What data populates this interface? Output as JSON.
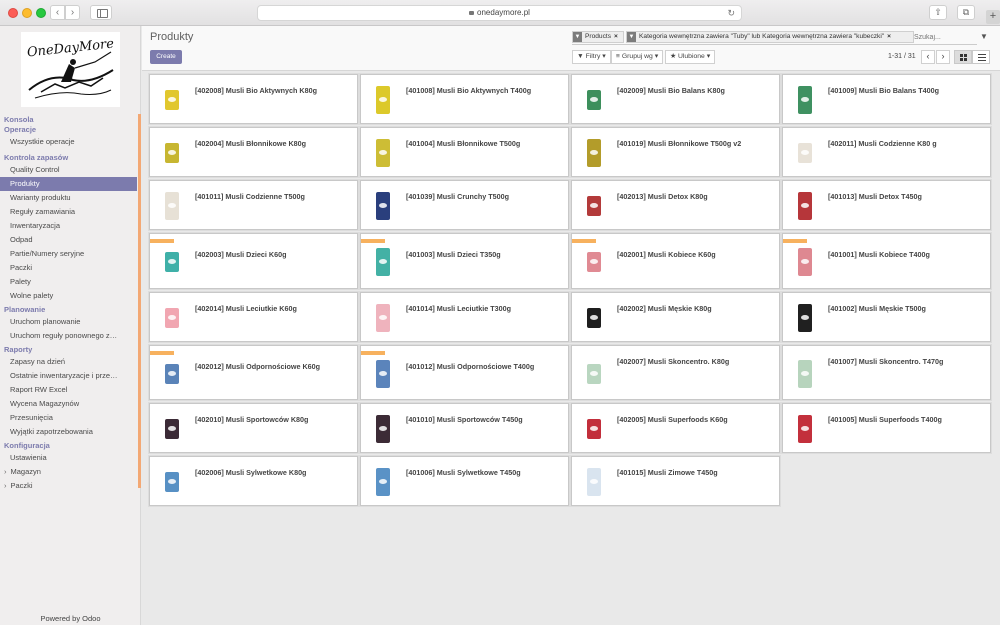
{
  "browser": {
    "url": "onedaymore.pl"
  },
  "sidebar": {
    "logo_text": "OneDayMore",
    "sections": [
      {
        "title": "Konsola",
        "items": []
      },
      {
        "title": "Operacje",
        "items": [
          {
            "label": "Wszystkie operacje"
          }
        ]
      },
      {
        "title": "Kontrola zapasów",
        "items": [
          {
            "label": "Quality Control"
          },
          {
            "label": "Produkty",
            "active": true
          },
          {
            "label": "Warianty produktu"
          },
          {
            "label": "Reguły zamawiania"
          },
          {
            "label": "Inwentaryzacja"
          },
          {
            "label": "Odpad"
          },
          {
            "label": "Partie/Numery seryjne"
          },
          {
            "label": "Paczki"
          },
          {
            "label": "Palety"
          },
          {
            "label": "Wolne palety"
          }
        ]
      },
      {
        "title": "Planowanie",
        "items": [
          {
            "label": "Uruchom planowanie"
          },
          {
            "label": "Uruchom reguły ponownego z…"
          }
        ]
      },
      {
        "title": "Raporty",
        "items": [
          {
            "label": "Zapasy na dzień"
          },
          {
            "label": "Ostatnie inwentaryzacje i prze…"
          },
          {
            "label": "Raport RW Excel"
          },
          {
            "label": "Wycena Magazynów"
          },
          {
            "label": "Przesunięcia"
          },
          {
            "label": "Wyjątki zapotrzebowania"
          }
        ]
      },
      {
        "title": "Konfiguracja",
        "items": [
          {
            "label": "Ustawienia"
          },
          {
            "label": "Magazyn",
            "sub": true
          },
          {
            "label": "Paczki",
            "sub": true
          }
        ]
      }
    ],
    "powered_by": "Powered by Odoo"
  },
  "control_panel": {
    "breadcrumb": "Produkty",
    "create_label": "Create",
    "facets": [
      {
        "label": "Products"
      },
      {
        "label": "Kategoria wewnętrzna zawiera \"Tuby\" lub Kategoria wewnętrzna zawiera \"kubeczki\""
      }
    ],
    "search_placeholder": "Szukaj...",
    "filters_label": "Filtry",
    "groupby_label": "Grupuj wg",
    "favorites_label": "Ulubione",
    "pager": "1-31 / 31"
  },
  "products": [
    {
      "name": "[402008] Musli Bio Aktywnych K80g",
      "color": "#e1c72e",
      "shape": "short",
      "tag": false
    },
    {
      "name": "[401008] Musli Bio Aktywnych T400g",
      "color": "#dcc92a",
      "shape": "tall",
      "tag": false
    },
    {
      "name": "[402009] Musli Bio Balans K80g",
      "color": "#3d8f5c",
      "shape": "short",
      "tag": false
    },
    {
      "name": "[401009] Musli Bio Balans T400g",
      "color": "#3f9161",
      "shape": "tall",
      "tag": false
    },
    {
      "name": "[402004] Musli Błonnikowe K80g",
      "color": "#c7b631",
      "shape": "short",
      "tag": false
    },
    {
      "name": "[401004] Musli Błonnikowe T500g",
      "color": "#cdbd35",
      "shape": "tall",
      "tag": false
    },
    {
      "name": "[401019] Musli Błonnikowe T500g v2",
      "color": "#b39c2a",
      "shape": "tall",
      "tag": false
    },
    {
      "name": "[402011] Musli Codzienne K80 g",
      "color": "#e8e2d8",
      "shape": "short",
      "tag": false
    },
    {
      "name": "[401011] Musli Codzienne T500g",
      "color": "#e7e1d6",
      "shape": "tall",
      "tag": false
    },
    {
      "name": "[401039] Musli Crunchy T500g",
      "color": "#2a3f7d",
      "shape": "tall",
      "tag": false
    },
    {
      "name": "[402013] Musli Detox K80g",
      "color": "#b33a3a",
      "shape": "short",
      "tag": false
    },
    {
      "name": "[401013] Musli Detox T450g",
      "color": "#b6363a",
      "shape": "tall",
      "tag": false
    },
    {
      "name": "[402003] Musli Dzieci K60g",
      "color": "#3fb0a8",
      "shape": "short",
      "tag": true
    },
    {
      "name": "[401003] Musli Dzieci T350g",
      "color": "#43b1a5",
      "shape": "tall",
      "tag": true
    },
    {
      "name": "[402001] Musli Kobiece K60g",
      "color": "#e08a93",
      "shape": "short",
      "tag": true
    },
    {
      "name": "[401001] Musli Kobiece T400g",
      "color": "#de8891",
      "shape": "tall",
      "tag": true
    },
    {
      "name": "[402014] Musli Leciutkie K60g",
      "color": "#f1a6b1",
      "shape": "short",
      "tag": false
    },
    {
      "name": "[401014] Musli Leciutkie T300g",
      "color": "#efb3bd",
      "shape": "tall",
      "tag": false
    },
    {
      "name": "[402002] Musli Męskie K80g",
      "color": "#1e1e1e",
      "shape": "short",
      "tag": false
    },
    {
      "name": "[401002] Musli Męskie T500g",
      "color": "#202020",
      "shape": "tall",
      "tag": false
    },
    {
      "name": "[402012] Musli Odpornościowe K60g",
      "color": "#5a83b8",
      "shape": "short",
      "tag": true
    },
    {
      "name": "[401012] Musli Odpornościowe T400g",
      "color": "#5b84bb",
      "shape": "tall",
      "tag": true
    },
    {
      "name": "[402007] Musli Skoncentro. K80g",
      "color": "#b9d6c0",
      "shape": "short",
      "tag": false
    },
    {
      "name": "[401007] Musli Skoncentro. T470g",
      "color": "#b7d4bd",
      "shape": "tall",
      "tag": false
    },
    {
      "name": "[402010] Musli Sportowców K80g",
      "color": "#3b2a36",
      "shape": "short",
      "tag": false
    },
    {
      "name": "[401010] Musli Sportowców T450g",
      "color": "#3c2b36",
      "shape": "tall",
      "tag": false
    },
    {
      "name": "[402005] Musli Superfoods K60g",
      "color": "#c22e3b",
      "shape": "short",
      "tag": false
    },
    {
      "name": "[401005] Musli Superfoods T400g",
      "color": "#c3303c",
      "shape": "tall",
      "tag": false
    },
    {
      "name": "[402006] Musli Sylwetkowe K80g",
      "color": "#5790c4",
      "shape": "short",
      "tag": false
    },
    {
      "name": "[401006] Musli Sylwetkowe T450g",
      "color": "#5a92c6",
      "shape": "tall",
      "tag": false
    },
    {
      "name": "[401015] Musli Zimowe T450g",
      "color": "#d9e4ef",
      "shape": "tall",
      "tag": false
    }
  ]
}
